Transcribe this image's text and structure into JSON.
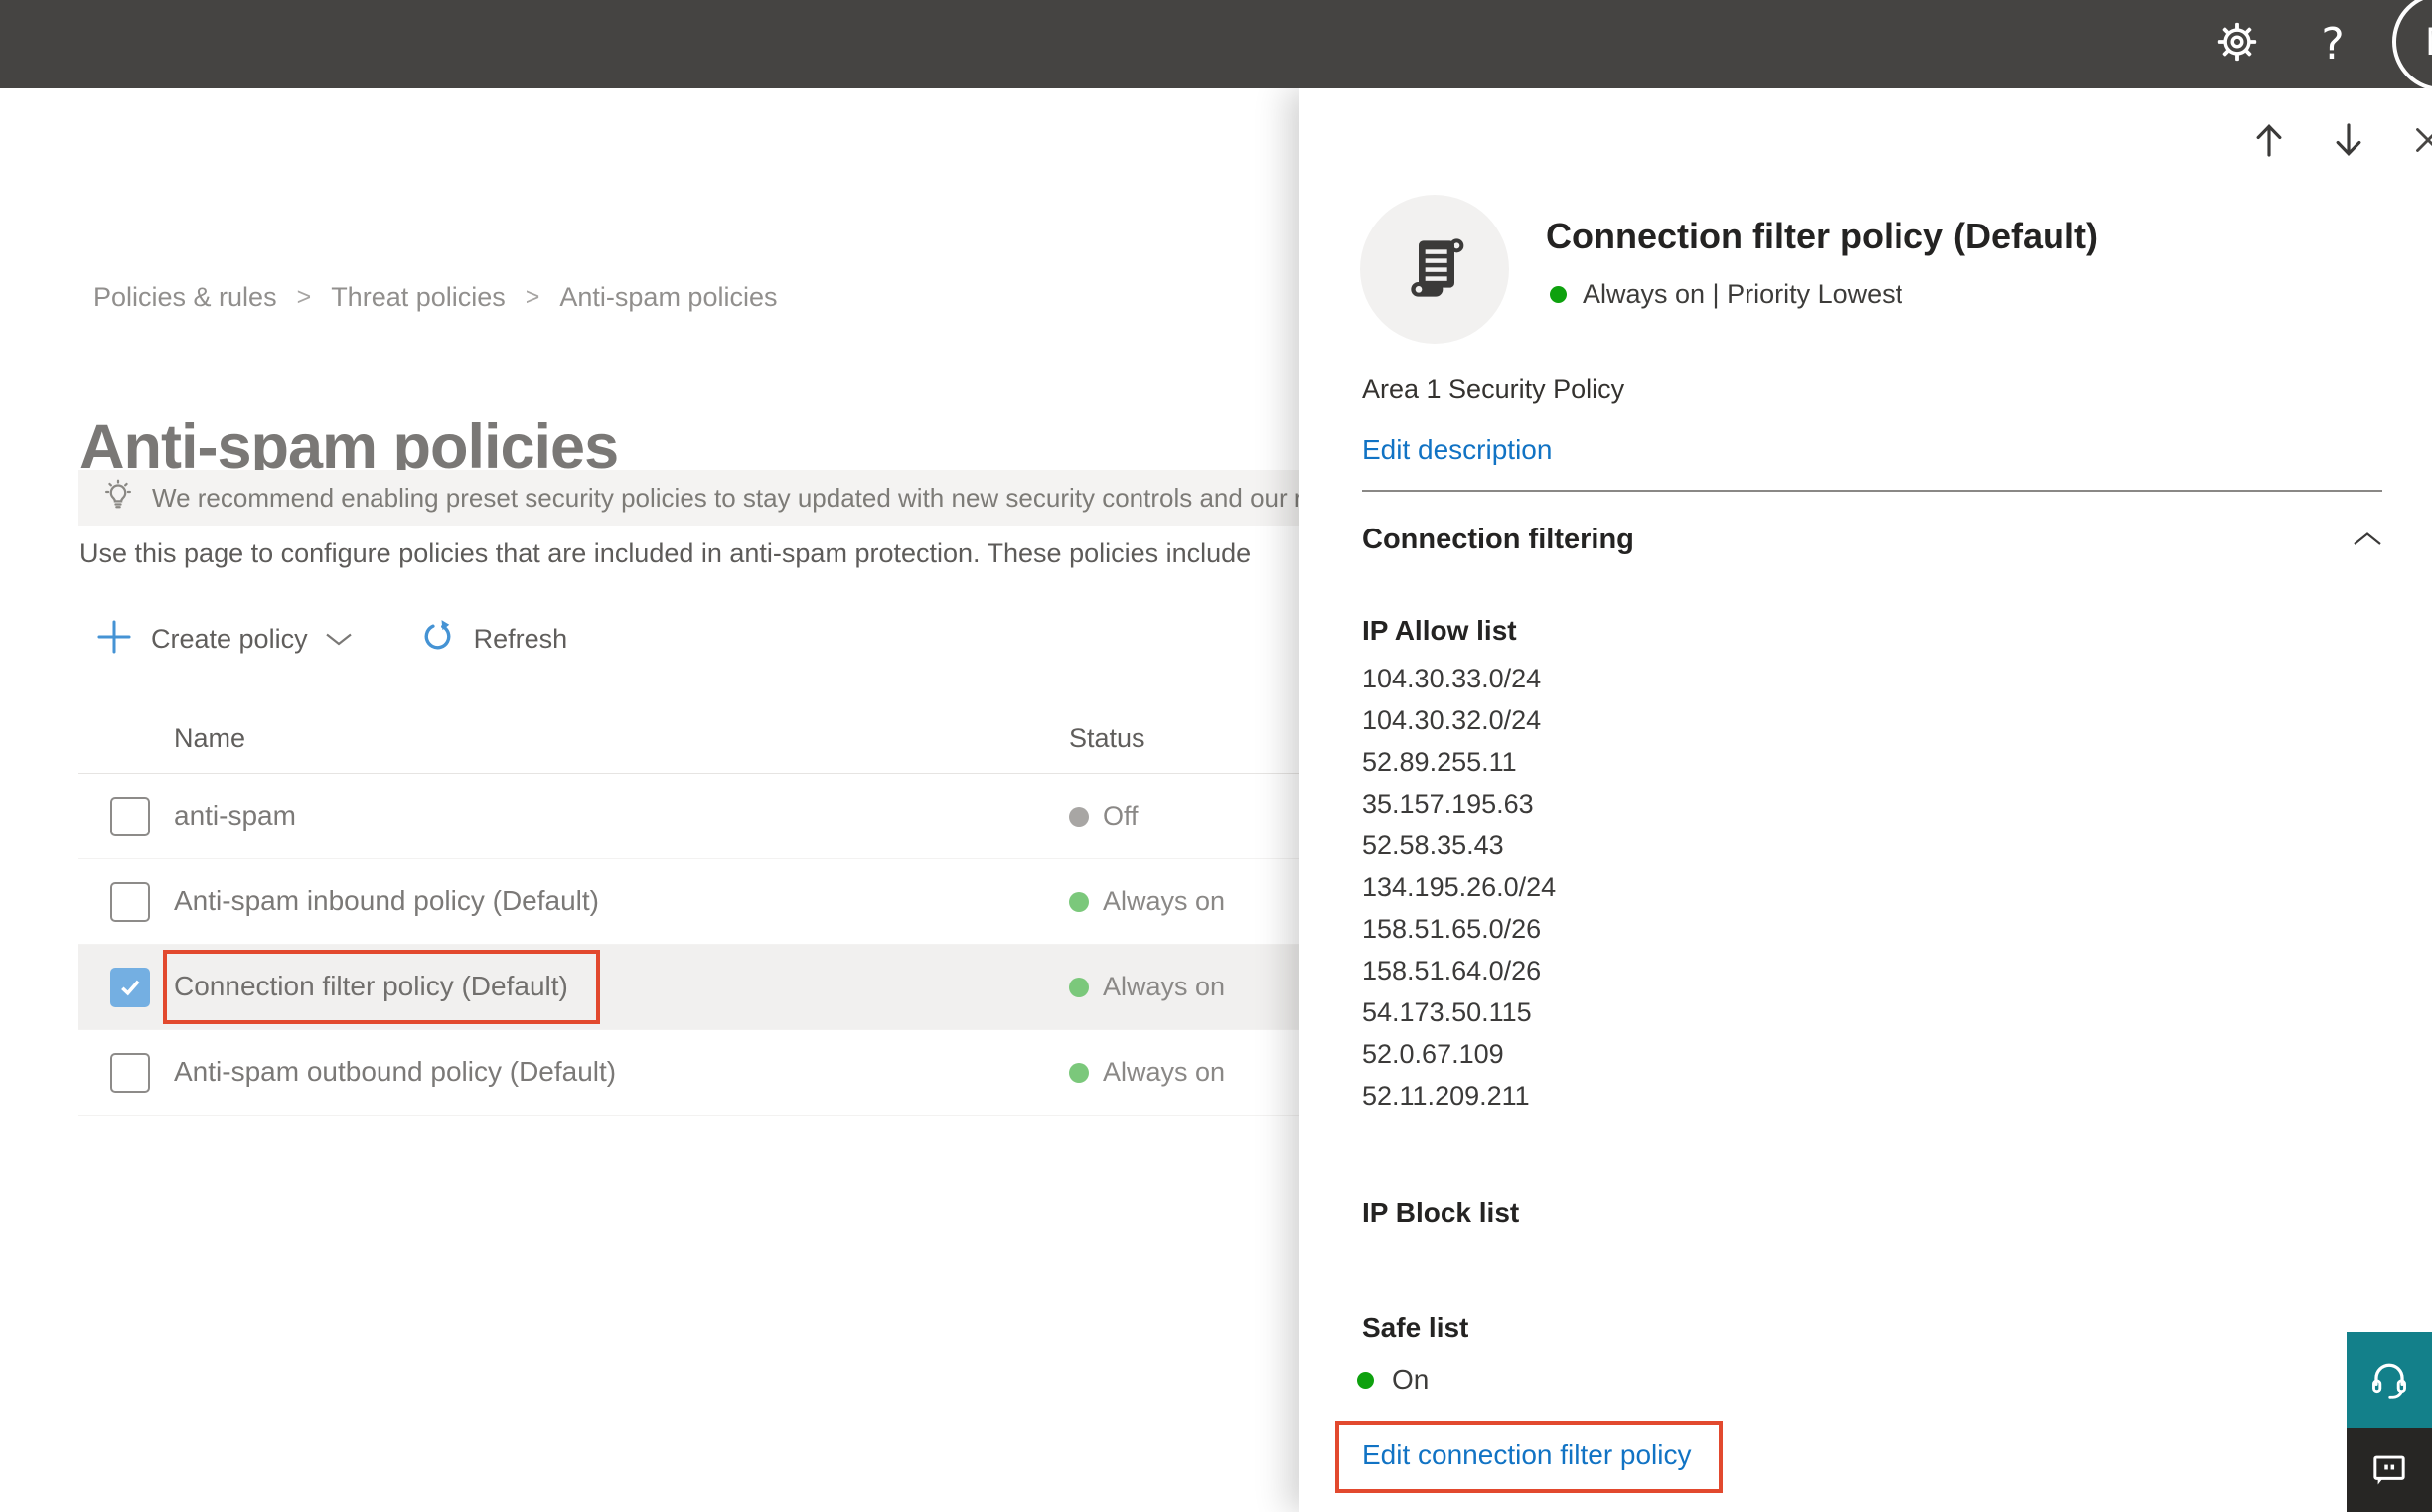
{
  "top_bar": {
    "help_label": "?",
    "avatar_initial": "M"
  },
  "breadcrumb": {
    "items": [
      "Policies & rules",
      "Threat policies",
      "Anti-spam policies"
    ],
    "separator": ">"
  },
  "page": {
    "title": "Anti-spam policies",
    "banner_text": "We recommend enabling preset security policies to stay updated with new security controls and our recomme",
    "description": "Use this page to configure policies that are included in anti-spam protection. These policies include"
  },
  "toolbar": {
    "create_policy_label": "Create policy",
    "refresh_label": "Refresh"
  },
  "table": {
    "columns": {
      "name": "Name",
      "status": "Status"
    },
    "rows": [
      {
        "name": "anti-spam",
        "status": "Off",
        "checked": false,
        "selected": false,
        "status_color": "gray"
      },
      {
        "name": "Anti-spam inbound policy (Default)",
        "status": "Always on",
        "checked": false,
        "selected": false,
        "status_color": "green"
      },
      {
        "name": "Connection filter policy (Default)",
        "status": "Always on",
        "checked": true,
        "selected": true,
        "status_color": "green",
        "annotated": true
      },
      {
        "name": "Anti-spam outbound policy (Default)",
        "status": "Always on",
        "checked": false,
        "selected": false,
        "status_color": "green"
      }
    ]
  },
  "flyout": {
    "title": "Connection filter policy (Default)",
    "status_line": "Always on | Priority Lowest",
    "description": "Area 1 Security Policy",
    "edit_description_label": "Edit description",
    "section_title": "Connection filtering",
    "ip_allow_list_label": "IP Allow list",
    "ip_allow_list": [
      "104.30.33.0/24",
      "104.30.32.0/24",
      "52.89.255.11",
      "35.157.195.63",
      "52.58.35.43",
      "134.195.26.0/24",
      "158.51.65.0/26",
      "158.51.64.0/26",
      "54.173.50.115",
      "52.0.67.109",
      "52.11.209.211"
    ],
    "ip_block_list_label": "IP Block list",
    "safe_list_label": "Safe list",
    "safe_list_status": "On",
    "edit_link_label": "Edit connection filter policy"
  },
  "colors": {
    "top_bar": "#454442",
    "link_blue": "#1173c4",
    "annotation_red": "#e2492e",
    "flyout_status_green": "#0ea10e",
    "table_status_green": "#7bc87b",
    "table_status_gray": "#a8a6a4",
    "checkbox_checked_blue": "#74afe2",
    "support_teal": "#13808a",
    "feedback_dark": "#272624"
  }
}
